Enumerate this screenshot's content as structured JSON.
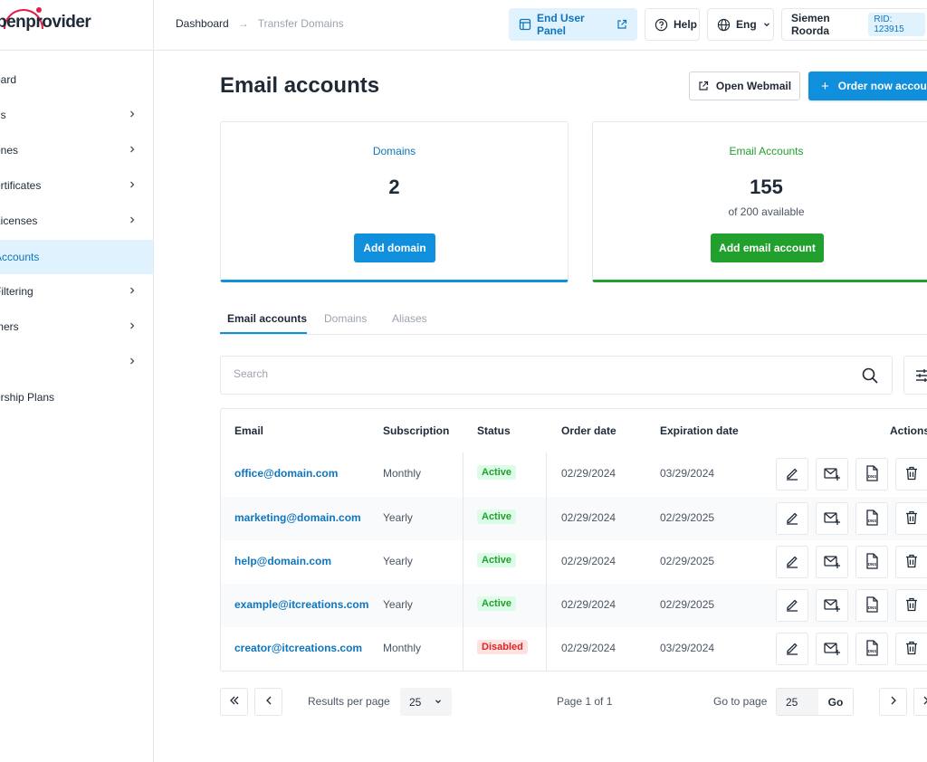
{
  "header": {
    "logo_text": "penprovider",
    "breadcrumb": {
      "current": "Dashboard",
      "next": "Transfer Domains"
    },
    "end_user_panel": "End User Panel",
    "help": "Help",
    "language": "Eng",
    "user_name": "Siemen Roorda",
    "rid": "RID: 123915"
  },
  "sidebar": {
    "items": [
      {
        "label": "oard",
        "chevron": false
      },
      {
        "label": "ns",
        "chevron": true
      },
      {
        "label": "ones",
        "chevron": true
      },
      {
        "label": "ertificates",
        "chevron": true
      },
      {
        "label": "Licenses",
        "chevron": true
      },
      {
        "label": "Accounts",
        "chevron": false,
        "active": true
      },
      {
        "label": "Filtering",
        "chevron": true
      },
      {
        "label": "mers",
        "chevron": true
      },
      {
        "label": "",
        "chevron": true
      },
      {
        "label": "ership Plans",
        "chevron": false
      }
    ]
  },
  "main": {
    "title": "Email accounts",
    "open_webmail": "Open Webmail",
    "order_now": "Order now account"
  },
  "cards": {
    "domains": {
      "title": "Domains",
      "value": "2",
      "button": "Add domain"
    },
    "email_accounts": {
      "title": "Email Accounts",
      "value": "155",
      "sub": "of 200 available",
      "button": "Add email account"
    }
  },
  "tabs": [
    "Email accounts",
    "Domains",
    "Aliases"
  ],
  "search": {
    "placeholder": "Search"
  },
  "table": {
    "columns": [
      "Email",
      "Subscription",
      "Status",
      "Order date",
      "Expiration date",
      "Actions"
    ],
    "rows": [
      {
        "email": "office@domain.com",
        "subscription": "Monthly",
        "status": "Active",
        "order_date": "02/29/2024",
        "expiration_date": "03/29/2024"
      },
      {
        "email": "marketing@domain.com",
        "subscription": "Yearly",
        "status": "Active",
        "order_date": "02/29/2024",
        "expiration_date": "02/29/2025"
      },
      {
        "email": "help@domain.com",
        "subscription": "Yearly",
        "status": "Active",
        "order_date": "02/29/2024",
        "expiration_date": "02/29/2025"
      },
      {
        "email": "example@itcreations.com",
        "subscription": "Yearly",
        "status": "Active",
        "order_date": "02/29/2024",
        "expiration_date": "02/29/2025"
      },
      {
        "email": "creator@itcreations.com",
        "subscription": "Monthly",
        "status": "Disabled",
        "order_date": "02/29/2024",
        "expiration_date": "03/29/2024"
      }
    ]
  },
  "pagination": {
    "results_per_page_label": "Results per page",
    "results_per_page_value": "25",
    "page_info": "Page 1 of 1",
    "goto_label": "Go to page",
    "goto_value": "25",
    "go_button": "Go"
  },
  "colors": {
    "primary": "#0f8fdc",
    "success": "#22a02d",
    "danger": "#dc2626",
    "brand": "#e11d48"
  }
}
